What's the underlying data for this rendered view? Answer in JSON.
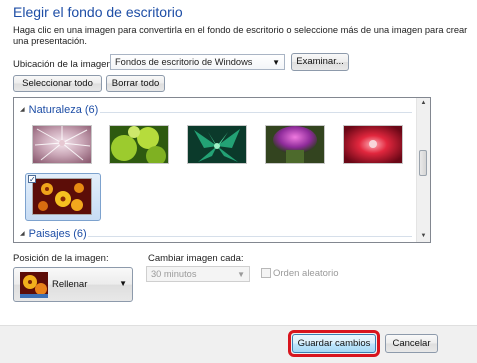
{
  "title": "Elegir el fondo de escritorio",
  "description": "Haga clic en una imagen para convertirla en el fondo de escritorio o seleccione más de una imagen para crear una presentación.",
  "location": {
    "label": "Ubicación de la imagen:",
    "value": "Fondos de escritorio de Windows",
    "browse_label": "Examinar..."
  },
  "buttons": {
    "select_all": "Seleccionar todo",
    "clear_all": "Borrar todo",
    "save": "Guardar cambios",
    "cancel": "Cancelar"
  },
  "groups": [
    {
      "name": "Naturaleza (6)",
      "expanded": true,
      "selected_count": 1
    },
    {
      "name": "Paisajes (6)",
      "expanded": true
    }
  ],
  "position": {
    "label": "Posición de la imagen:",
    "value": "Rellenar"
  },
  "interval": {
    "label": "Cambiar imagen cada:",
    "value": "30 minutos",
    "enabled": false
  },
  "shuffle": {
    "label": "Orden aleatorio",
    "checked": false,
    "enabled": false
  },
  "icons": {
    "group_toggle": "collapse-triangle-icon",
    "scroll_up": "scroll-up-arrow-icon",
    "scroll_down": "scroll-down-arrow-icon",
    "dropdown": "dropdown-arrow-icon",
    "checkmark": "checkmark-icon"
  },
  "colors": {
    "title": "#1e4ea6",
    "highlight": "#d8151e"
  }
}
